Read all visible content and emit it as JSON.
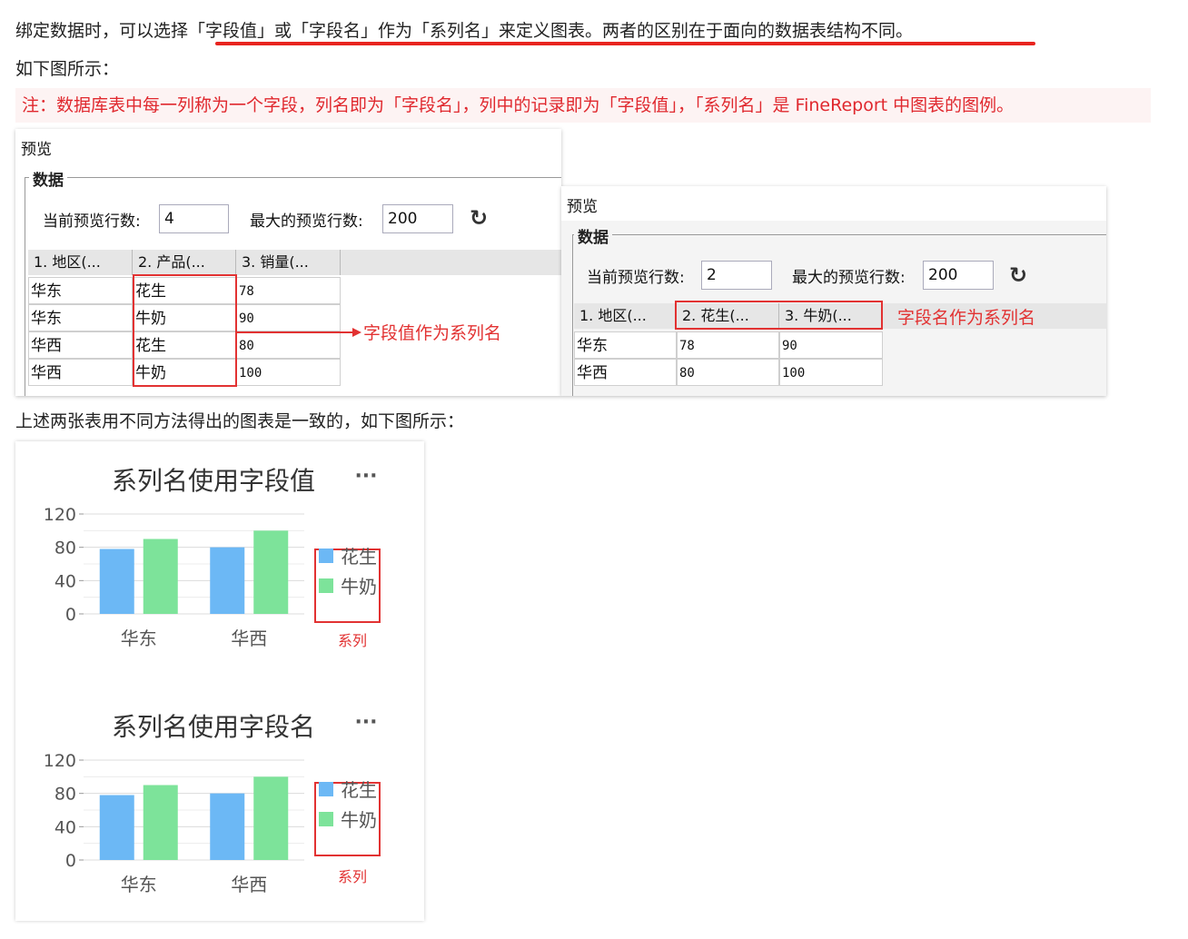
{
  "paragraphs": {
    "intro": "绑定数据时，可以选择「字段值」或「字段名」作为「系列名」来定义图表。两者的区别在于面向的数据表结构不同。",
    "as_shown": "如下图所示：",
    "note": "注：数据库表中每一列称为一个字段，列名即为「字段名」，列中的记录即为「字段值」，「系列名」是 FineReport 中图表的图例。",
    "result": "上述两张表用不同方法得出的图表是一致的，如下图所示："
  },
  "colors": {
    "accent_red": "#e23232",
    "blue_series": "#6cb8f5",
    "green_series": "#7de39a"
  },
  "dialog_left": {
    "title": "预览",
    "section": "数据",
    "current_rows_label": "当前预览行数:",
    "current_rows_value": "4",
    "max_rows_label": "最大的预览行数:",
    "max_rows_value": "200",
    "refresh_icon": "refresh-icon",
    "headers": [
      "1. 地区(...",
      "2. 产品(...",
      "3. 销量(..."
    ],
    "rows": [
      [
        "华东",
        "花生",
        "78"
      ],
      [
        "华东",
        "牛奶",
        "90"
      ],
      [
        "华西",
        "花生",
        "80"
      ],
      [
        "华西",
        "牛奶",
        "100"
      ]
    ],
    "annotation": "字段值作为系列名"
  },
  "dialog_right": {
    "title": "预览",
    "section": "数据",
    "current_rows_label": "当前预览行数:",
    "current_rows_value": "2",
    "max_rows_label": "最大的预览行数:",
    "max_rows_value": "200",
    "refresh_icon": "refresh-icon",
    "headers": [
      "1. 地区(...",
      "2. 花生(...",
      "3. 牛奶(..."
    ],
    "rows": [
      [
        "华东",
        "78",
        "90"
      ],
      [
        "华西",
        "80",
        "100"
      ]
    ],
    "annotation": "字段名作为系列名"
  },
  "menu_icon": "more-icon",
  "legend_caption": "系列",
  "chart_data": [
    {
      "type": "bar",
      "title": "系列名使用字段值",
      "categories": [
        "华东",
        "华西"
      ],
      "series": [
        {
          "name": "花生",
          "values": [
            78,
            80
          ]
        },
        {
          "name": "牛奶",
          "values": [
            90,
            100
          ]
        }
      ],
      "ylim": [
        0,
        120
      ],
      "yticks": [
        0,
        40,
        80,
        120
      ],
      "legend_position": "right"
    },
    {
      "type": "bar",
      "title": "系列名使用字段名",
      "categories": [
        "华东",
        "华西"
      ],
      "series": [
        {
          "name": "花生",
          "values": [
            78,
            80
          ]
        },
        {
          "name": "牛奶",
          "values": [
            90,
            100
          ]
        }
      ],
      "ylim": [
        0,
        120
      ],
      "yticks": [
        0,
        40,
        80,
        120
      ],
      "legend_position": "right"
    }
  ]
}
